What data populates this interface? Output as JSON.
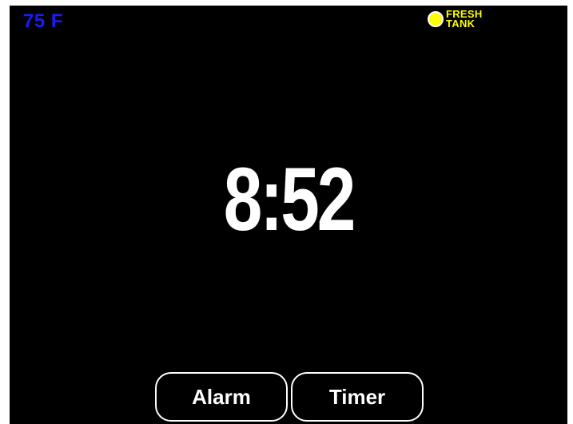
{
  "status": {
    "temperature": "75 F",
    "temperature_color": "#1a1aff",
    "tank": {
      "icon": "status-dot-icon",
      "indicator_color": "#ffff00",
      "label_line1": "FRESH",
      "label_line2": "TANK",
      "label_color": "#ffff00"
    }
  },
  "clock": {
    "time": "8:52"
  },
  "buttons": {
    "alarm_label": "Alarm",
    "timer_label": "Timer"
  }
}
